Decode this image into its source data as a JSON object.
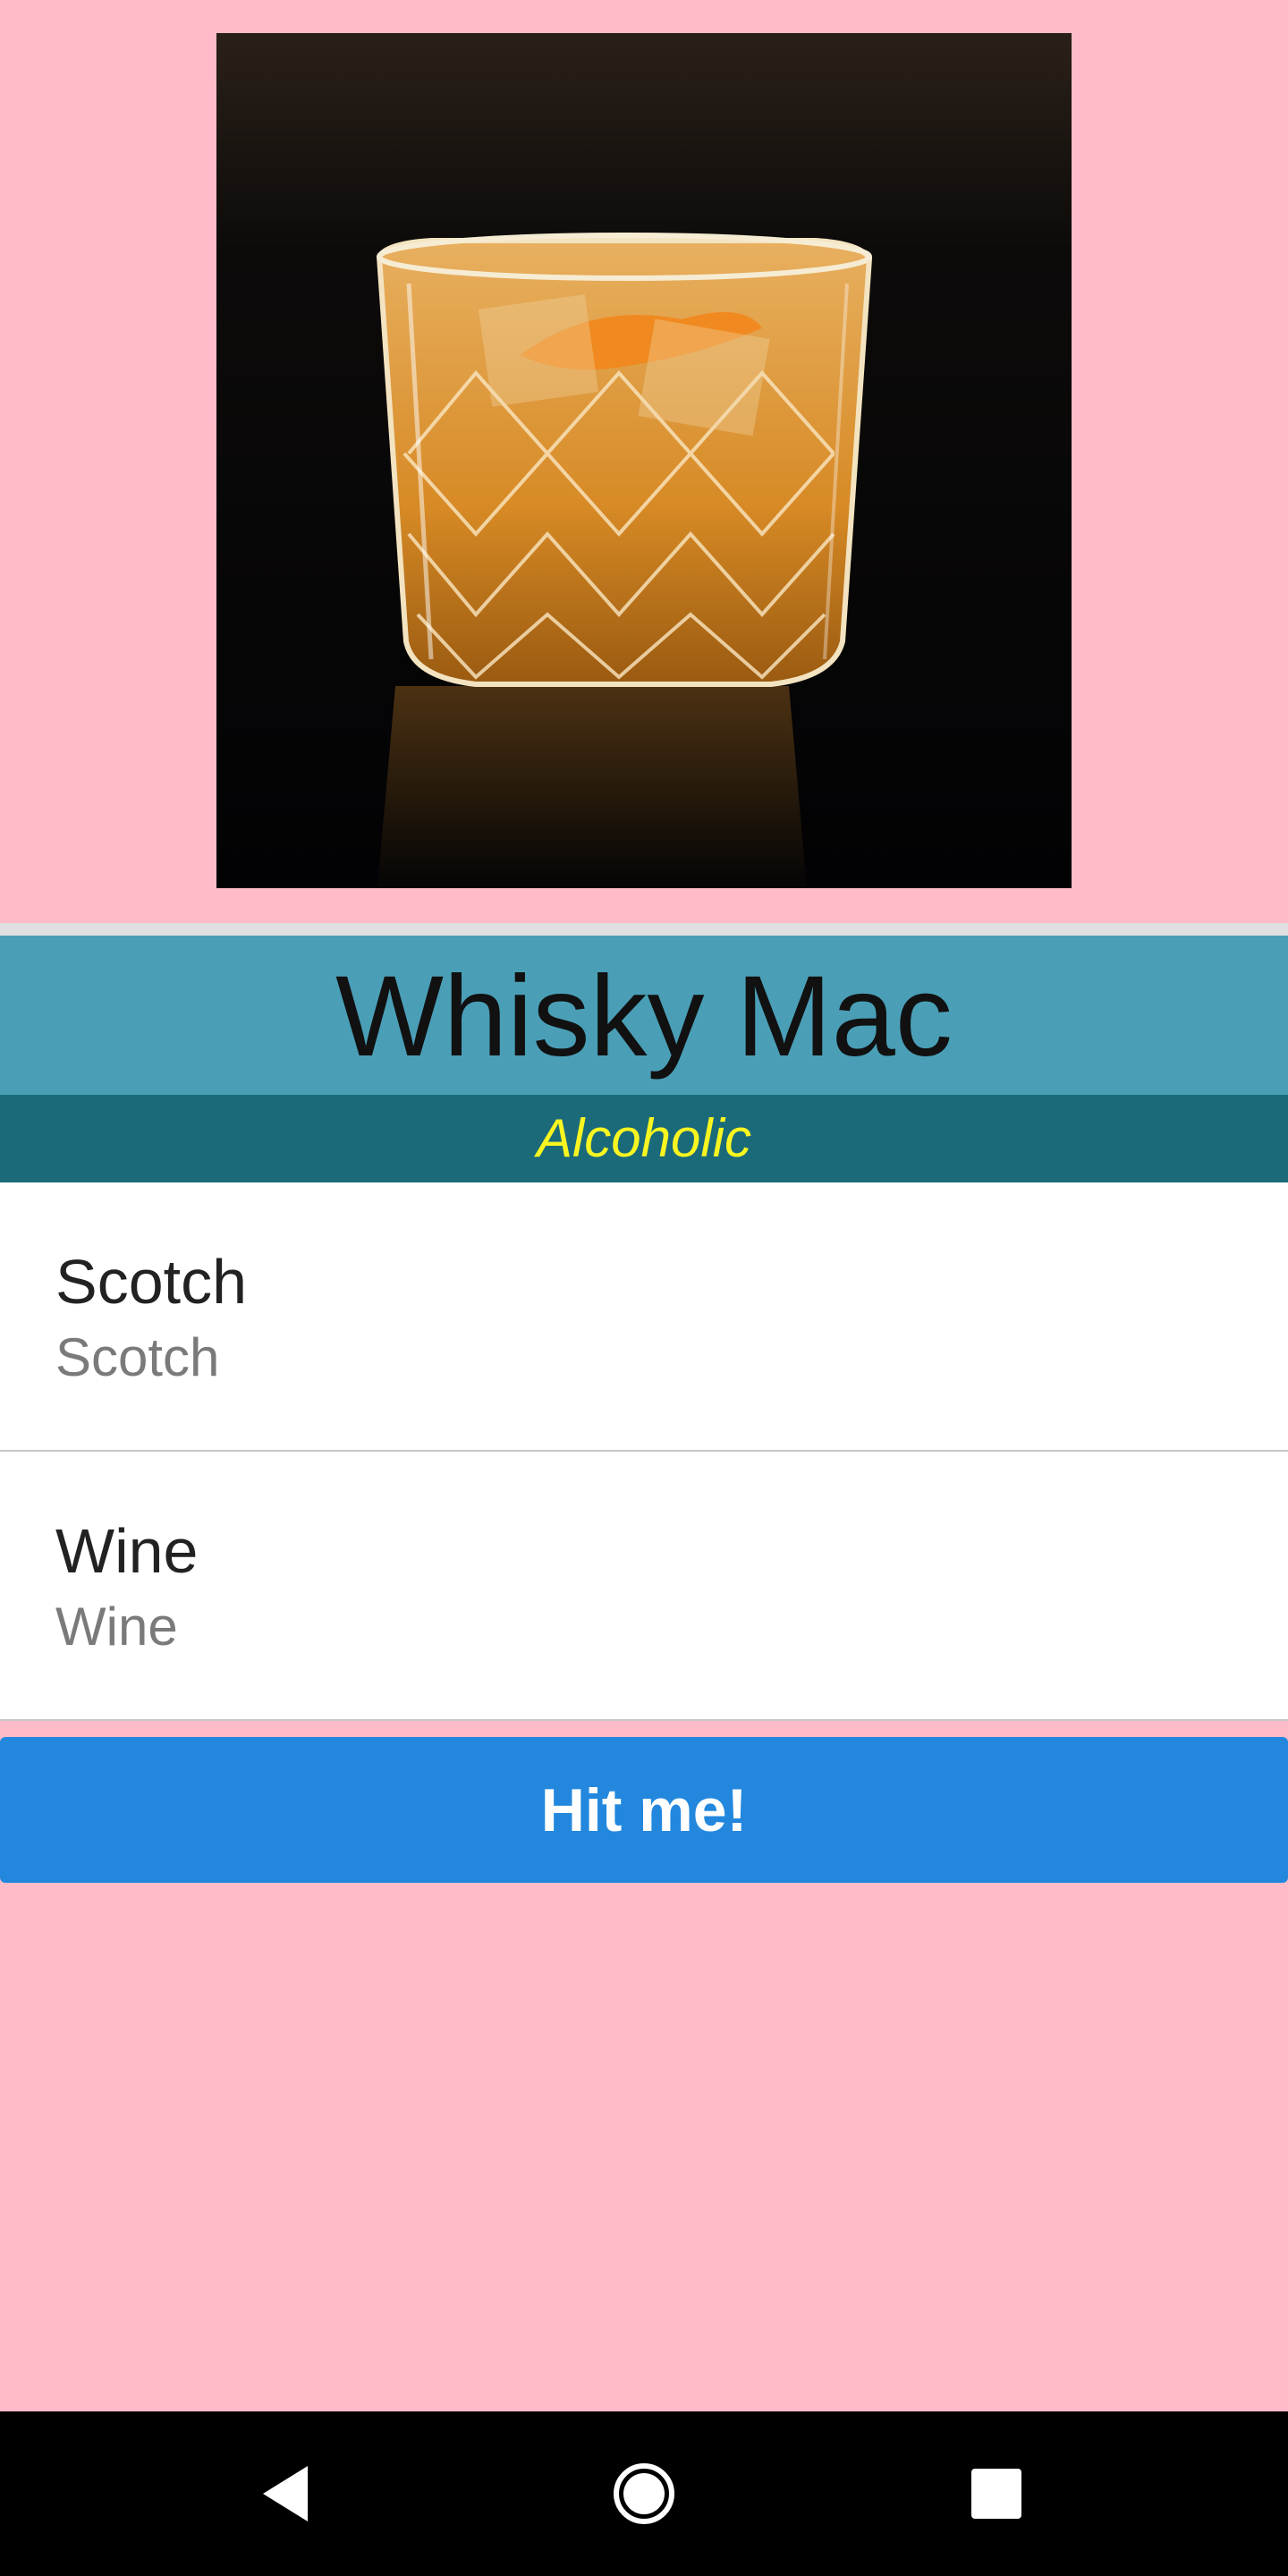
{
  "drink": {
    "name": "Whisky Mac",
    "category": "Alcoholic",
    "image_alt": "whisky-glass-photo"
  },
  "ingredients": [
    {
      "name": "Scotch",
      "measure": "Scotch"
    },
    {
      "name": "Wine",
      "measure": "Wine"
    }
  ],
  "actions": {
    "hit_label": "Hit me!"
  },
  "navbar": {
    "back_icon": "back-triangle-icon",
    "home_icon": "home-circle-icon",
    "recent_icon": "recent-apps-square-icon"
  },
  "colors": {
    "background": "#ffbcc8",
    "title_bar": "#4a9fb7",
    "category_bar": "#1a6a7a",
    "category_text": "#f8f520",
    "button": "#2388dd"
  }
}
